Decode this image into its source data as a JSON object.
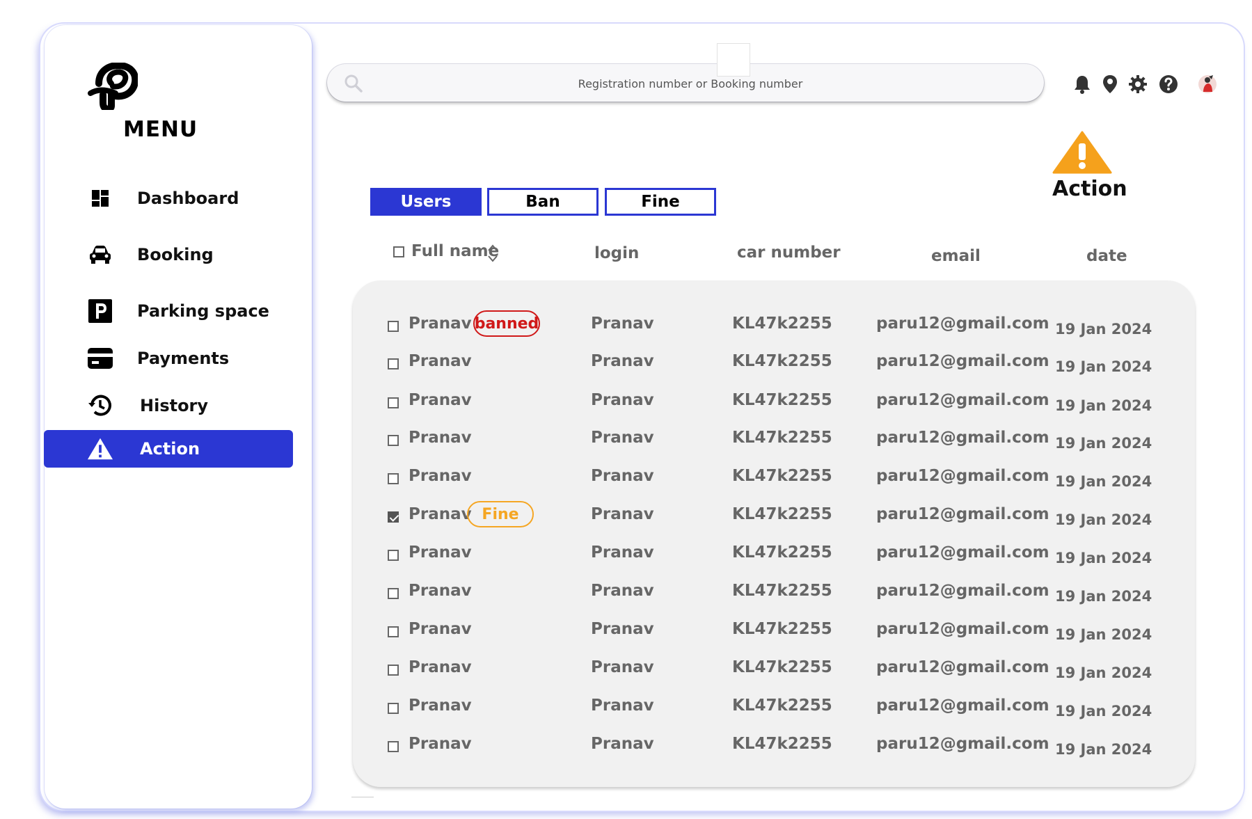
{
  "sidebar": {
    "menu_title": "MENU",
    "items": [
      {
        "label": "Dashboard",
        "icon": "dashboard-icon"
      },
      {
        "label": "Booking",
        "icon": "car-icon"
      },
      {
        "label": "Parking space",
        "icon": "parking-icon"
      },
      {
        "label": "Payments",
        "icon": "card-icon"
      },
      {
        "label": "History",
        "icon": "history-icon"
      },
      {
        "label": "Action",
        "icon": "warning-icon",
        "active": true
      }
    ]
  },
  "search": {
    "placeholder": "Registration number or Booking number"
  },
  "topbar": {
    "icons": [
      "bell-icon",
      "location-pin-icon",
      "gear-icon",
      "help-icon",
      "avatar"
    ]
  },
  "page": {
    "title": "Action",
    "title_icon": "warning-icon",
    "accent": "#2b37d3",
    "warning_color": "#f5a11c"
  },
  "tabs": [
    {
      "label": "Users",
      "active": true
    },
    {
      "label": "Ban",
      "active": false
    },
    {
      "label": "Fine",
      "active": false
    }
  ],
  "table": {
    "headers": {
      "full_name": "Full name",
      "login": "login",
      "car_number": "car number",
      "email": "email",
      "date": "date"
    },
    "rows": [
      {
        "name": "Pranav",
        "badge": "banned",
        "login": "Pranav",
        "car": "KL47k2255",
        "email": "paru12@gmail.com",
        "date": "19 Jan 2024",
        "checked": false
      },
      {
        "name": "Pranav",
        "badge": "",
        "login": "Pranav",
        "car": "KL47k2255",
        "email": "paru12@gmail.com",
        "date": "19 Jan 2024",
        "checked": false
      },
      {
        "name": "Pranav",
        "badge": "",
        "login": "Pranav",
        "car": "KL47k2255",
        "email": "paru12@gmail.com",
        "date": "19 Jan 2024",
        "checked": false
      },
      {
        "name": "Pranav",
        "badge": "",
        "login": "Pranav",
        "car": "KL47k2255",
        "email": "paru12@gmail.com",
        "date": "19 Jan 2024",
        "checked": false
      },
      {
        "name": "Pranav",
        "badge": "",
        "login": "Pranav",
        "car": "KL47k2255",
        "email": "paru12@gmail.com",
        "date": "19 Jan 2024",
        "checked": false
      },
      {
        "name": "Pranav",
        "badge": "Fine",
        "login": "Pranav",
        "car": "KL47k2255",
        "email": "paru12@gmail.com",
        "date": "19 Jan 2024",
        "checked": true
      },
      {
        "name": "Pranav",
        "badge": "",
        "login": "Pranav",
        "car": "KL47k2255",
        "email": "paru12@gmail.com",
        "date": "19 Jan 2024",
        "checked": false
      },
      {
        "name": "Pranav",
        "badge": "",
        "login": "Pranav",
        "car": "KL47k2255",
        "email": "paru12@gmail.com",
        "date": "19 Jan 2024",
        "checked": false
      },
      {
        "name": "Pranav",
        "badge": "",
        "login": "Pranav",
        "car": "KL47k2255",
        "email": "paru12@gmail.com",
        "date": "19 Jan 2024",
        "checked": false
      },
      {
        "name": "Pranav",
        "badge": "",
        "login": "Pranav",
        "car": "KL47k2255",
        "email": "paru12@gmail.com",
        "date": "19 Jan 2024",
        "checked": false
      },
      {
        "name": "Pranav",
        "badge": "",
        "login": "Pranav",
        "car": "KL47k2255",
        "email": "paru12@gmail.com",
        "date": "19 Jan 2024",
        "checked": false
      },
      {
        "name": "Pranav",
        "badge": "",
        "login": "Pranav",
        "car": "KL47k2255",
        "email": "paru12@gmail.com",
        "date": "19 Jan 2024",
        "checked": false
      }
    ]
  }
}
